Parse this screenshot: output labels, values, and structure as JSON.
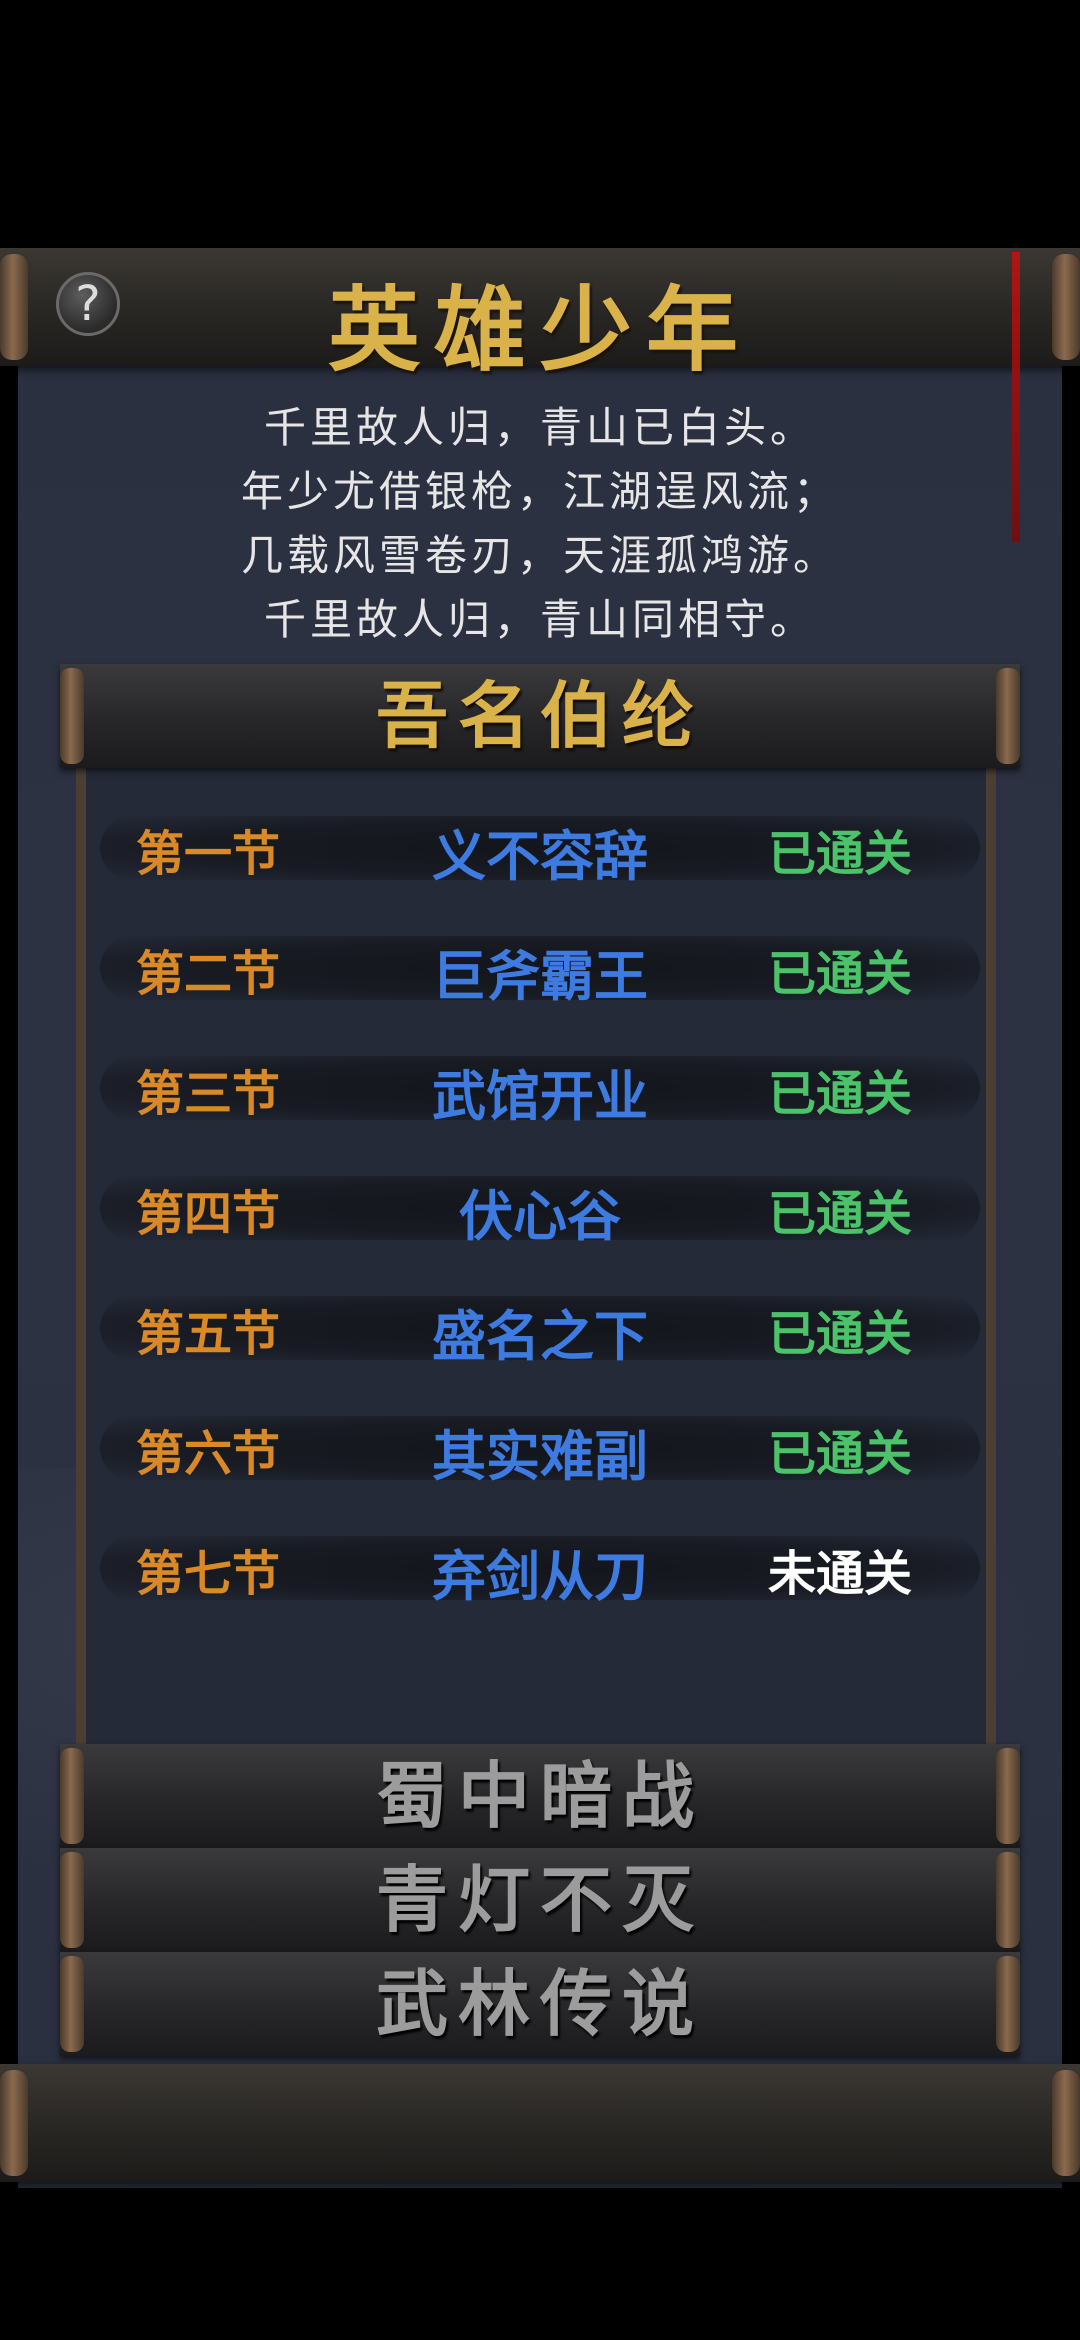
{
  "header": {
    "title": "英雄少年",
    "help_symbol": "?"
  },
  "poem": [
    "千里故人归，青山已白头。",
    "年少尤借银枪，江湖逞风流；",
    "几载风雪卷刃，天涯孤鸿游。",
    "千里故人归，青山同相守。"
  ],
  "active_section": {
    "title": "吾名伯纶",
    "chapters": [
      {
        "chapter": "第一节",
        "name": "义不容辞",
        "status": "已通关"
      },
      {
        "chapter": "第二节",
        "name": "巨斧霸王",
        "status": "已通关"
      },
      {
        "chapter": "第三节",
        "name": "武馆开业",
        "status": "已通关"
      },
      {
        "chapter": "第四节",
        "name": "伏心谷",
        "status": "已通关"
      },
      {
        "chapter": "第五节",
        "name": "盛名之下",
        "status": "已通关"
      },
      {
        "chapter": "第六节",
        "name": "其实难副",
        "status": "已通关"
      },
      {
        "chapter": "第七节",
        "name": "弃剑从刀",
        "status": "未通关"
      }
    ]
  },
  "other_sections": [
    "蜀中暗战",
    "青灯不灭",
    "武林传说"
  ],
  "colors": {
    "title_gold": "#d9b24a",
    "chapter_orange": "#d98a26",
    "name_blue": "#3d7be0",
    "cleared_green": "#4cc36a",
    "uncleared_white": "#ffffff",
    "inactive_gray": "#9c9c9c"
  }
}
